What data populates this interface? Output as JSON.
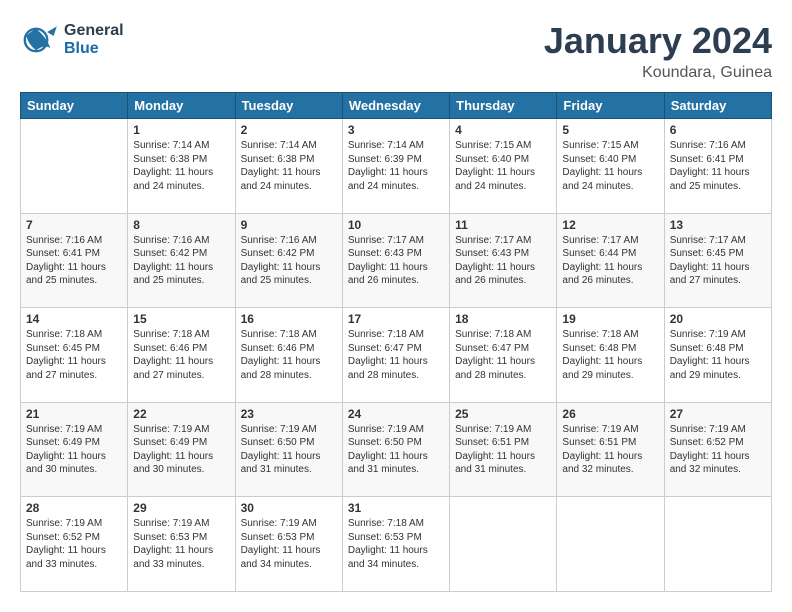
{
  "logo": {
    "general": "General",
    "blue": "Blue"
  },
  "title": "January 2024",
  "location": "Koundara, Guinea",
  "days_header": [
    "Sunday",
    "Monday",
    "Tuesday",
    "Wednesday",
    "Thursday",
    "Friday",
    "Saturday"
  ],
  "weeks": [
    {
      "days": [
        {
          "num": "",
          "info": ""
        },
        {
          "num": "1",
          "info": "Sunrise: 7:14 AM\nSunset: 6:38 PM\nDaylight: 11 hours\nand 24 minutes."
        },
        {
          "num": "2",
          "info": "Sunrise: 7:14 AM\nSunset: 6:38 PM\nDaylight: 11 hours\nand 24 minutes."
        },
        {
          "num": "3",
          "info": "Sunrise: 7:14 AM\nSunset: 6:39 PM\nDaylight: 11 hours\nand 24 minutes."
        },
        {
          "num": "4",
          "info": "Sunrise: 7:15 AM\nSunset: 6:40 PM\nDaylight: 11 hours\nand 24 minutes."
        },
        {
          "num": "5",
          "info": "Sunrise: 7:15 AM\nSunset: 6:40 PM\nDaylight: 11 hours\nand 24 minutes."
        },
        {
          "num": "6",
          "info": "Sunrise: 7:16 AM\nSunset: 6:41 PM\nDaylight: 11 hours\nand 25 minutes."
        }
      ]
    },
    {
      "days": [
        {
          "num": "7",
          "info": "Sunrise: 7:16 AM\nSunset: 6:41 PM\nDaylight: 11 hours\nand 25 minutes."
        },
        {
          "num": "8",
          "info": "Sunrise: 7:16 AM\nSunset: 6:42 PM\nDaylight: 11 hours\nand 25 minutes."
        },
        {
          "num": "9",
          "info": "Sunrise: 7:16 AM\nSunset: 6:42 PM\nDaylight: 11 hours\nand 25 minutes."
        },
        {
          "num": "10",
          "info": "Sunrise: 7:17 AM\nSunset: 6:43 PM\nDaylight: 11 hours\nand 26 minutes."
        },
        {
          "num": "11",
          "info": "Sunrise: 7:17 AM\nSunset: 6:43 PM\nDaylight: 11 hours\nand 26 minutes."
        },
        {
          "num": "12",
          "info": "Sunrise: 7:17 AM\nSunset: 6:44 PM\nDaylight: 11 hours\nand 26 minutes."
        },
        {
          "num": "13",
          "info": "Sunrise: 7:17 AM\nSunset: 6:45 PM\nDaylight: 11 hours\nand 27 minutes."
        }
      ]
    },
    {
      "days": [
        {
          "num": "14",
          "info": "Sunrise: 7:18 AM\nSunset: 6:45 PM\nDaylight: 11 hours\nand 27 minutes."
        },
        {
          "num": "15",
          "info": "Sunrise: 7:18 AM\nSunset: 6:46 PM\nDaylight: 11 hours\nand 27 minutes."
        },
        {
          "num": "16",
          "info": "Sunrise: 7:18 AM\nSunset: 6:46 PM\nDaylight: 11 hours\nand 28 minutes."
        },
        {
          "num": "17",
          "info": "Sunrise: 7:18 AM\nSunset: 6:47 PM\nDaylight: 11 hours\nand 28 minutes."
        },
        {
          "num": "18",
          "info": "Sunrise: 7:18 AM\nSunset: 6:47 PM\nDaylight: 11 hours\nand 28 minutes."
        },
        {
          "num": "19",
          "info": "Sunrise: 7:18 AM\nSunset: 6:48 PM\nDaylight: 11 hours\nand 29 minutes."
        },
        {
          "num": "20",
          "info": "Sunrise: 7:19 AM\nSunset: 6:48 PM\nDaylight: 11 hours\nand 29 minutes."
        }
      ]
    },
    {
      "days": [
        {
          "num": "21",
          "info": "Sunrise: 7:19 AM\nSunset: 6:49 PM\nDaylight: 11 hours\nand 30 minutes."
        },
        {
          "num": "22",
          "info": "Sunrise: 7:19 AM\nSunset: 6:49 PM\nDaylight: 11 hours\nand 30 minutes."
        },
        {
          "num": "23",
          "info": "Sunrise: 7:19 AM\nSunset: 6:50 PM\nDaylight: 11 hours\nand 31 minutes."
        },
        {
          "num": "24",
          "info": "Sunrise: 7:19 AM\nSunset: 6:50 PM\nDaylight: 11 hours\nand 31 minutes."
        },
        {
          "num": "25",
          "info": "Sunrise: 7:19 AM\nSunset: 6:51 PM\nDaylight: 11 hours\nand 31 minutes."
        },
        {
          "num": "26",
          "info": "Sunrise: 7:19 AM\nSunset: 6:51 PM\nDaylight: 11 hours\nand 32 minutes."
        },
        {
          "num": "27",
          "info": "Sunrise: 7:19 AM\nSunset: 6:52 PM\nDaylight: 11 hours\nand 32 minutes."
        }
      ]
    },
    {
      "days": [
        {
          "num": "28",
          "info": "Sunrise: 7:19 AM\nSunset: 6:52 PM\nDaylight: 11 hours\nand 33 minutes."
        },
        {
          "num": "29",
          "info": "Sunrise: 7:19 AM\nSunset: 6:53 PM\nDaylight: 11 hours\nand 33 minutes."
        },
        {
          "num": "30",
          "info": "Sunrise: 7:19 AM\nSunset: 6:53 PM\nDaylight: 11 hours\nand 34 minutes."
        },
        {
          "num": "31",
          "info": "Sunrise: 7:18 AM\nSunset: 6:53 PM\nDaylight: 11 hours\nand 34 minutes."
        },
        {
          "num": "",
          "info": ""
        },
        {
          "num": "",
          "info": ""
        },
        {
          "num": "",
          "info": ""
        }
      ]
    }
  ]
}
